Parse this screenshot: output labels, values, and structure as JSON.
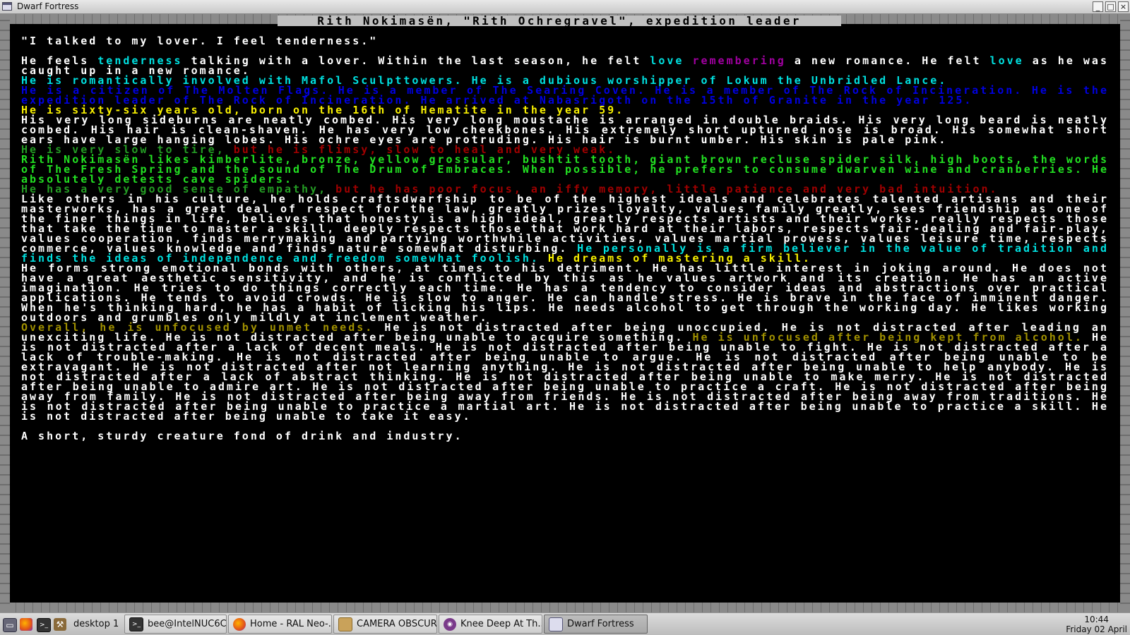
{
  "window": {
    "title": "Dwarf Fortress",
    "buttons": [
      "_",
      "□",
      "×"
    ]
  },
  "game": {
    "title": "Rith Nokimasën, \"Rith Ochregravel\", expedition leader",
    "quote": "\"I talked to my lover. I feel tenderness.\"",
    "p1": {
      "a": "He feels ",
      "b": "tenderness",
      "c": " talking with a lover. Within the last season, he felt ",
      "d": "love",
      "e": " remembering",
      "f": " a new romance. He felt ",
      "g": "love",
      "h": " as he was caught up in a new romance."
    },
    "relationship": "He is romantically involved with Mafol Sculpttowers. He is a dubious worshipper of Lokum the Unbridled Lance.",
    "membership": "He is a citizen of The Molten Flags. He is a member of The Searing Coven. He is a member of The Rock of Incineration. He is the expedition leader of The Rock of Incineration. He arrived at Nabasrigoth on the 15th of Granite in the year 125.",
    "age": "He is sixty-six years old, born on the 16th of Hematite in the year 59.",
    "appearance": "His very long sideburns are neatly combed. His very long moustache is arranged in double braids. His very long beard is neatly combed. His hair is clean-shaven. He has very low cheekbones. His extremely short upturned nose is broad. His somewhat short ears have large hanging lobes. His ochre eyes are protruding. His hair is burnt umber. His skin is pale pink.",
    "physical": {
      "good": "He is very slow to tire,",
      "bad": " but he is flimsy, slow to heal and very weak."
    },
    "likes": "Rith Nokimasën likes kimberlite, bronze, yellow grossular, bushtit tooth, giant brown recluse spider silk, high boots, the words of The Fresh Spring and the sound of The Drum of Embraces. When possible, he prefers to consume dwarven wine and cranberries. He absolutely detests cave spiders.",
    "mental": {
      "good": "He has a very good sense of empathy,",
      "bad": " but he has poor focus, an iffy memory, little patience and very bad intuition."
    },
    "values": {
      "a": "Like others in his culture, he holds craftsdwarfship to be of the highest ideals and celebrates talented artisans and their masterworks, has a great deal of respect for the law, greatly prizes loyalty, values family greatly, sees friendship as one of the finer things in life, believes that honesty is a high ideal, greatly respects artists and their works, really respects those that take the time to master a skill, deeply respects those that work hard at their labors, respects fair-dealing and fair-play, values cooperation, finds merrymaking and partying worthwhile activities, values martial prowess, values leisure time, respects commerce, values knowledge and finds nature somewhat disturbing.",
      "b": " He personally is a firm believer in the value of tradition and finds the ideas of independence and freedom somewhat foolish.",
      "c": " He dreams of mastering a skill."
    },
    "personality": "He forms strong emotional bonds with others, at times to his detriment. He has little interest in joking around. He does not have a great aesthetic sensitivity, and he is conflicted by this as he values artwork and its creation. He has an active imagination. He tries to do things correctly each time. He has a tendency to consider ideas and abstractions over practical applications. He tends to avoid crowds. He is slow to anger. He can handle stress. He is brave in the face of imminent danger. When he's thinking hard, he has a habit of licking his lips. He needs alcohol to get through the working day. He likes working outdoors and grumbles only mildly at inclement weather.",
    "needs": {
      "a": "Overall, he is unfocused by unmet needs.",
      "b": " He is not distracted after being unoccupied. He is not distracted after leading an unexciting life. He is not distracted after being unable to acquire something.",
      "c": " He is unfocused after being kept from alcohol.",
      "d": " He is not distracted after a lack of decent meals. He is not distracted after being unable to fight. He is not distracted after a lack of trouble-making. He is not distracted after being unable to argue. He is not distracted after being unable to be extravagant. He is not distracted after not learning anything. He is not distracted after being unable to help anybody. He is not distracted after a lack of abstract thinking. He is not distracted after being unable to make merry. He is not distracted after being unable to admire art. He is not distracted after being unable to practice a craft. He is not distracted after being away from family. He is not distracted after being away from friends. He is not distracted after being away from traditions. He is not distracted after being unable to practice a martial art. He is not distracted after being unable to practice a skill. He is not distracted after being unable to take it easy."
    },
    "description": "A short, sturdy creature fond of drink and industry."
  },
  "taskbar": {
    "workspace": "desktop 1",
    "tasks": [
      {
        "label": "bee@IntelNUC6C...",
        "icon": "terminal-icon"
      },
      {
        "label": "Home - RAL Neo-...",
        "icon": "firefox-icon"
      },
      {
        "label": "CAMERA OBSCUR...",
        "icon": "folder-icon"
      },
      {
        "label": "Knee Deep At Th...",
        "icon": "media-player-icon"
      },
      {
        "label": "Dwarf Fortress",
        "icon": "window-icon"
      }
    ],
    "clock": {
      "time": "10:44",
      "date": "Friday 02 April"
    }
  },
  "colors": {
    "default_text": "#c0c0c0",
    "white": "#ffffff",
    "cyan": "#00e0e0",
    "magenta": "#a000a0",
    "blue": "#0000e0",
    "yellow": "#f8f000",
    "dark_green": "#249c24",
    "light_green": "#22e022",
    "red": "#a00000",
    "brown": "#a09000"
  }
}
